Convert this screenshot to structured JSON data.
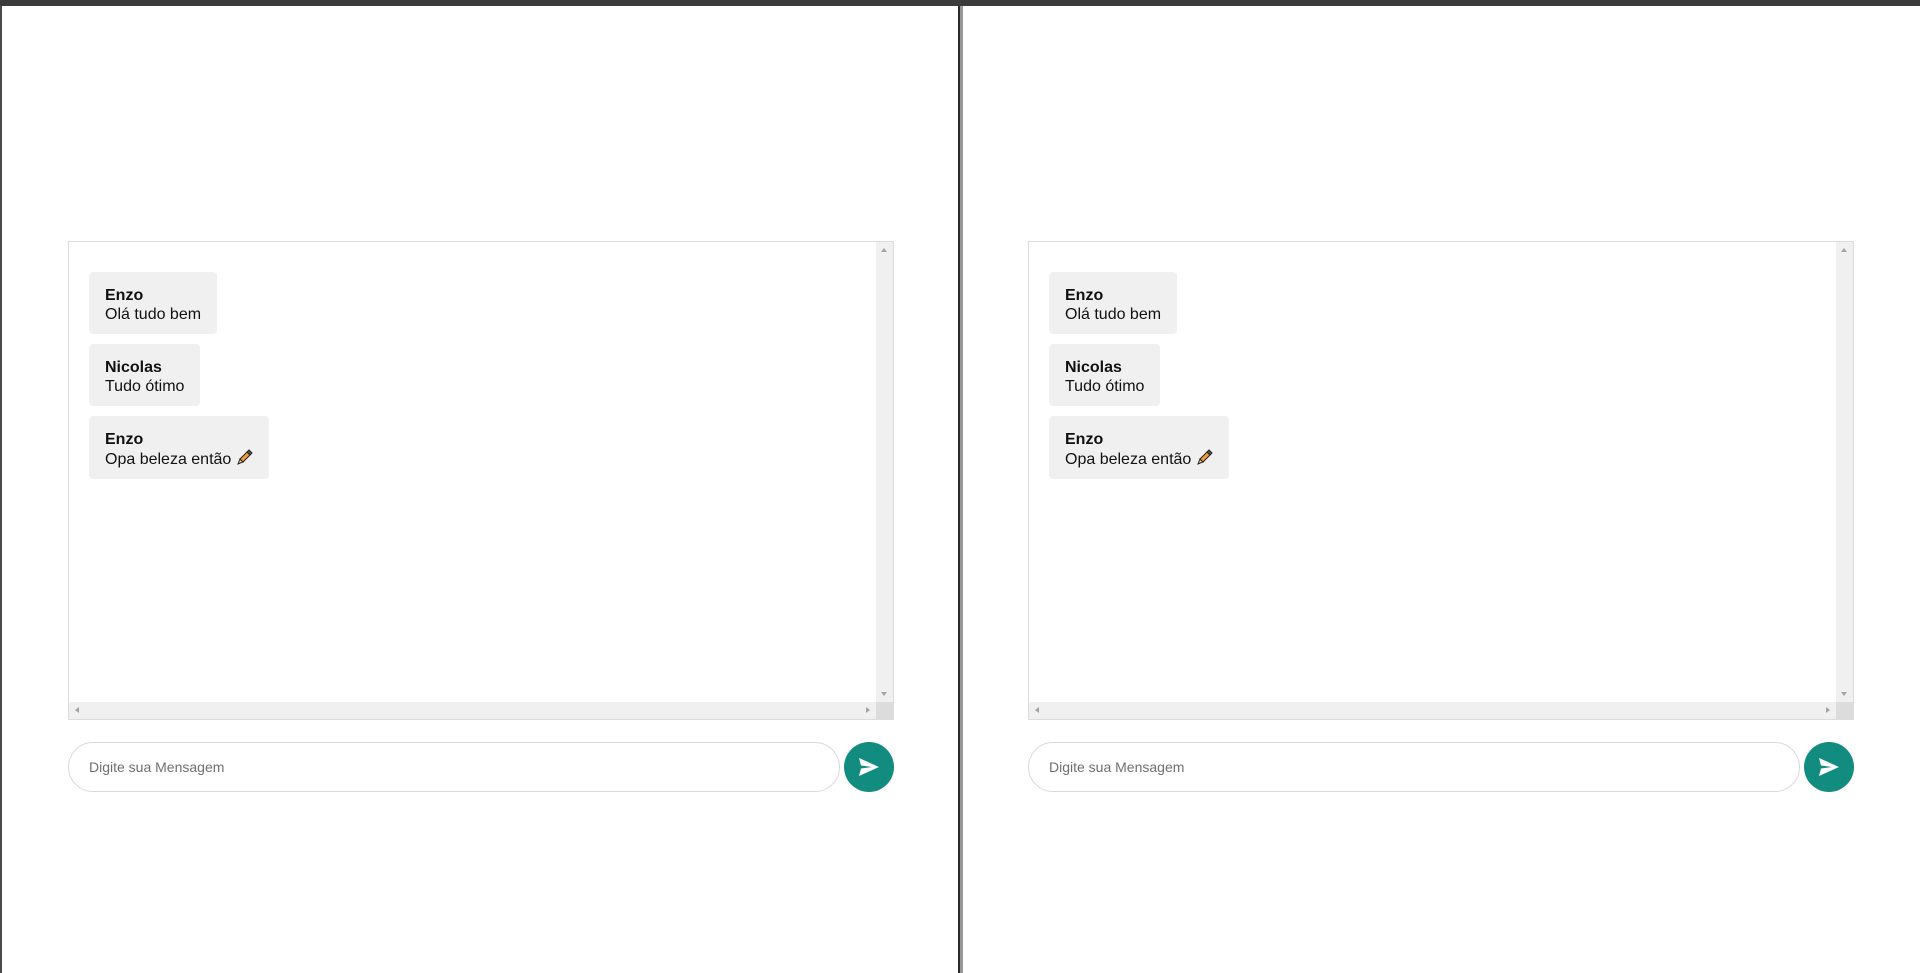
{
  "windows": [
    {
      "id": "left",
      "messages": [
        {
          "author": "Enzo",
          "text": "Olá tudo bem"
        },
        {
          "author": "Nicolas",
          "text": "Tudo ótimo"
        },
        {
          "author": "Enzo",
          "text": "Opa beleza então",
          "emoji": "pencil-icon"
        }
      ],
      "input": {
        "placeholder": "Digite sua Mensagem",
        "value": ""
      },
      "send_icon": "send-icon"
    },
    {
      "id": "right",
      "messages": [
        {
          "author": "Enzo",
          "text": "Olá tudo bem"
        },
        {
          "author": "Nicolas",
          "text": "Tudo ótimo"
        },
        {
          "author": "Enzo",
          "text": "Opa beleza então",
          "emoji": "pencil-icon"
        }
      ],
      "input": {
        "placeholder": "Digite sua Mensagem",
        "value": ""
      },
      "send_icon": "send-icon"
    }
  ],
  "colors": {
    "accent": "#128c7e",
    "message_bg": "#f0f0f0",
    "topbar": "#3b3b3b"
  }
}
